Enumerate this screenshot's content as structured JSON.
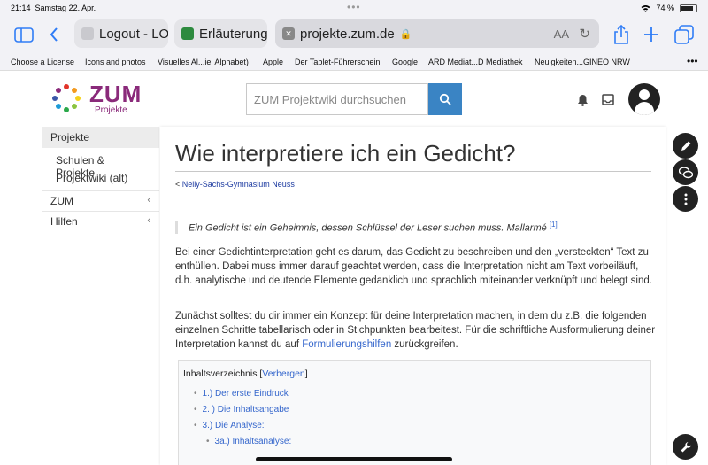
{
  "status": {
    "time": "21:14",
    "date": "Samstag 22. Apr.",
    "battery": "74 %"
  },
  "tabs": [
    {
      "label": "Logout - LO",
      "favicon_color": "#c9c9ce"
    },
    {
      "label": "Erläuterung",
      "favicon_color": "#2d8a3e"
    },
    {
      "label": "projekte.zum.de",
      "favicon_color": "#888888"
    }
  ],
  "toolbar": {
    "text_size": "AA"
  },
  "bookmarks": [
    "Choose a License",
    "Icons and photos",
    "Visuelles Al...iel Alphabet)",
    "Apple",
    "Der Tablet-Führerschein",
    "Google",
    "ARD Mediat...D Mediathek",
    "Neuigkeiten...GINEO NRW"
  ],
  "header": {
    "logo_word": "ZUM",
    "logo_sub": "Projekte",
    "search_placeholder": "ZUM Projektwiki durchsuchen"
  },
  "sidebar": {
    "head": "Projekte",
    "items": [
      "Schulen & Projekte",
      "Projektwiki (alt)"
    ],
    "groups": [
      "ZUM",
      "Hilfen"
    ]
  },
  "article": {
    "title": "Wie interpretiere ich ein Gedicht?",
    "breadcrumb_prefix": "<",
    "breadcrumb": "Nelly-Sachs-Gymnasium Neuss",
    "quote": "Ein Gedicht ist ein Geheimnis, dessen Schlüssel der Leser suchen muss. Mallarmé",
    "quote_ref": "[1]",
    "p1": "Bei einer Gedichtinterpretation geht es darum, das Gedicht zu beschreiben und den „versteckten“ Text zu enthüllen. Dabei muss immer darauf geachtet werden, dass die Interpretation nicht am Text vorbeiläuft, d.h. analytische und deutende Elemente gedanklich und sprachlich miteinander verknüpft und belegt sind.",
    "p2_start": "Zunächst solltest du dir immer ein Konzept für deine Interpretation machen, in dem du z.B. die folgenden einzelnen Schritte tabellarisch oder in Stichpunkten bearbeitest. Für die schriftliche Ausformulierung deiner Interpretation kannst du auf ",
    "p2_link": "Formulierungshilfen",
    "p2_end": " zurückgreifen."
  },
  "toc": {
    "title": "Inhaltsverzeichnis",
    "toggle_open": "[",
    "toggle": "Verbergen",
    "toggle_close": "]",
    "items": [
      "1.) Der erste Eindruck",
      "2. ) Die Inhaltsangabe",
      "3.) Die Analyse:",
      "3a.) Inhaltsanalyse:"
    ]
  },
  "colors": {
    "brand": "#8a2a7a",
    "accent": "#3a84c4",
    "link": "#3466cc"
  }
}
